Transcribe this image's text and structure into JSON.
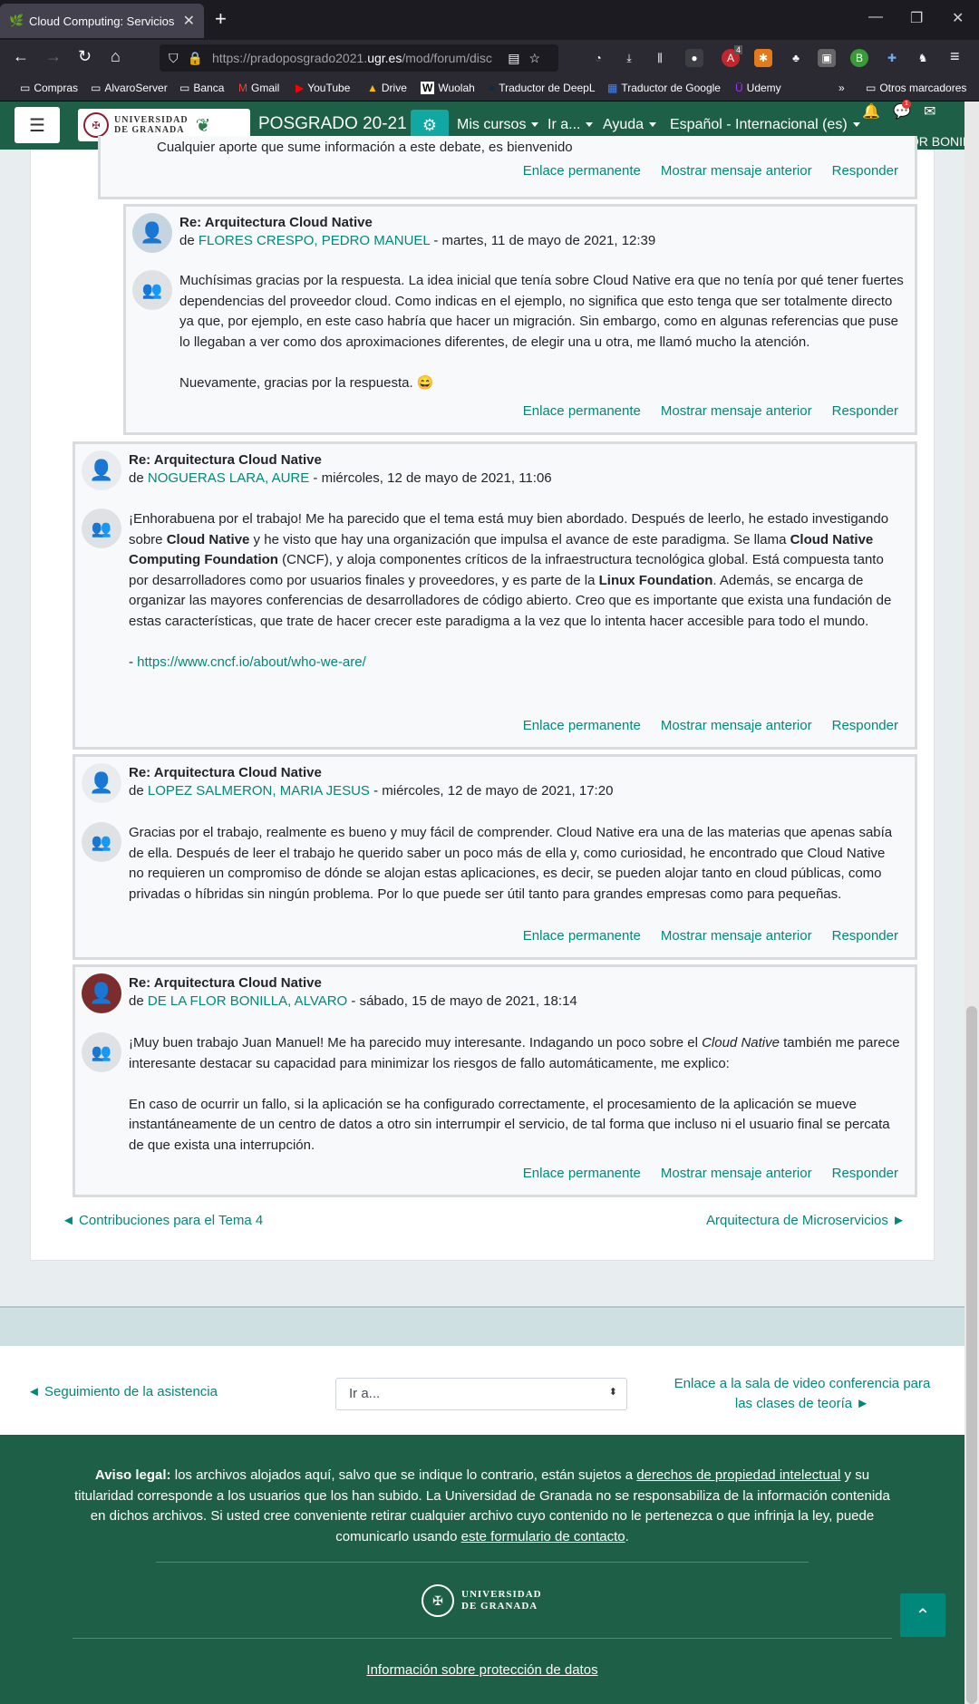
{
  "browser": {
    "tab_title": "Cloud Computing: Servicios y A",
    "url_prefix": "https://pradoposgrado2021.",
    "url_domain": "ugr.es",
    "url_path": "/mod/forum/disc",
    "bookmarks": [
      "Compras",
      "AlvaroServer",
      "Banca",
      "Gmail",
      "YouTube",
      "Drive",
      "Wuolah",
      "Traductor de DeepL",
      "Traductor de Google",
      "Udemy"
    ],
    "other_bookmarks": "Otros marcadores",
    "abp_badge": "4"
  },
  "moodle": {
    "university_name_line1": "UNIVERSIDAD",
    "university_name_line2": "DE GRANADA",
    "site_name": "POSGRADO 20-21",
    "menu": [
      "Mis cursos",
      "Ir a...",
      "Ayuda",
      "Español - Internacional (es)"
    ],
    "user_name": "DE LA FLOR BONILLA",
    "notif_count": "1"
  },
  "prev_post": {
    "snippet": "Cualquier aporte que sume información a este debate, es bienvenido"
  },
  "actions": {
    "permalink": "Enlace permanente",
    "show_parent": "Mostrar mensaje anterior",
    "reply": "Responder"
  },
  "posts": [
    {
      "title": "Re: Arquitectura Cloud Native",
      "by_prefix": "de",
      "author": "FLORES CRESPO, PEDRO MANUEL",
      "date": " - martes, 11 de mayo de 2021, 12:39",
      "paragraphs": [
        "Muchísimas gracias por la respuesta. La idea inicial que tenía sobre Cloud Native era que no tenía por qué tener fuertes dependencias del proveedor cloud. Como indicas en el ejemplo, no significa que esto tenga que ser totalmente directo ya que, por ejemplo, en este caso habría que hacer un migración. Sin embargo, como en algunas referencias que puse lo llegaban a ver como dos aproximaciones diferentes, de elegir una u otra, me llamó mucho la atención.",
        "Nuevamente, gracias por la respuesta. 😄"
      ]
    },
    {
      "title": "Re: Arquitectura Cloud Native",
      "by_prefix": "de",
      "author": "NOGUERAS LARA, AURE",
      "date": " - miércoles, 12 de mayo de 2021, 11:06",
      "p1_a": "¡Enhorabuena por el trabajo! Me ha parecido que el tema está muy bien abordado. Después de leerlo, he estado investigando sobre ",
      "p1_b": "Cloud Native",
      "p1_c": " y he visto que hay una organización que impulsa el avance de este paradigma. Se llama ",
      "p1_d": "Cloud Native Computing Foundation",
      "p1_e": " (CNCF), y aloja componentes críticos de la infraestructura tecnológica global. Está compuesta tanto por desarrolladores como por usuarios finales y proveedores, y es parte de la ",
      "p1_f": "Linux Foundation",
      "p1_g": ". Además, se encarga de organizar las mayores conferencias de desarrolladores de código abierto. Creo que es importante que exista una fundación de estas características, que trate de hacer crecer este paradigma a la vez que lo intenta hacer accesible para todo el mundo.",
      "link_prefix": "- ",
      "link": "https://www.cncf.io/about/who-we-are/"
    },
    {
      "title": "Re: Arquitectura Cloud Native",
      "by_prefix": "de",
      "author": "LOPEZ SALMERON, MARIA JESUS",
      "date": " - miércoles, 12 de mayo de 2021, 17:20",
      "paragraphs": [
        "Gracias por el trabajo, realmente es bueno y muy fácil de comprender. Cloud Native era una de las materias que apenas sabía de ella. Después de leer el trabajo he querido saber un poco más de ella y, como curiosidad, he encontrado que Cloud Native no requieren un compromiso de dónde se alojan estas aplicaciones, es decir, se pueden alojar tanto en cloud públicas, como privadas o híbridas sin ningún problema. Por lo que puede ser útil tanto para grandes empresas como para pequeñas."
      ]
    },
    {
      "title": "Re: Arquitectura Cloud Native",
      "by_prefix": "de",
      "author": "DE LA FLOR BONILLA, ALVARO",
      "date": " - sábado, 15 de mayo de 2021, 18:14",
      "p1_a": "¡Muy buen trabajo Juan Manuel! Me ha parecido muy interesante. Indagando un poco sobre el ",
      "p1_b": "Cloud Native",
      "p1_c": " también me parece interesante destacar su capacidad para minimizar los riesgos de fallo automáticamente, me explico:",
      "p2": "En caso de ocurrir un fallo, si la aplicación se ha configurado correctamente, el procesamiento de la aplicación se mueve instantáneamente de un centro de datos a otro sin interrumpir el servicio, de tal forma que incluso ni el usuario final se percata de que exista una interrupción."
    }
  ],
  "page_nav": {
    "prev": "◄ Contribuciones para el Tema 4",
    "next": "Arquitectura de Microservicios ►"
  },
  "activity_nav": {
    "prev": "◄ Seguimiento de la asistencia",
    "select_value": "Ir a...",
    "next_line1": "Enlace a la sala de video conferencia para",
    "next_line2": "las clases de teoría ►"
  },
  "footer": {
    "legal_bold": "Aviso legal:",
    "legal_1": " los archivos alojados aquí, salvo que se indique lo contrario, están sujetos a ",
    "legal_link1": "derechos de propiedad intelectual",
    "legal_2": " y su titularidad corresponde a los usuarios que los han subido. La Universidad de Granada no se responsabiliza de la información contenida en dichos archivos. Si usted cree conveniente retirar cualquier archivo cuyo contenido no le pertenezca o que infrinja la ley, puede comunicarlo usando ",
    "legal_link2": "este formulario de contacto",
    "legal_3": ".",
    "logo_line1": "UNIVERSIDAD",
    "logo_line2": "DE GRANADA",
    "privacy": "Información sobre protección de datos"
  }
}
